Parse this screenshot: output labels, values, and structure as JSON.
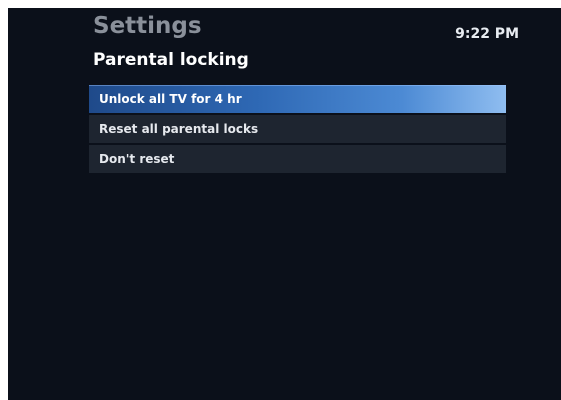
{
  "header": {
    "app_title": "Settings",
    "page_title": "Parental locking",
    "clock": "9:22 PM"
  },
  "menu": {
    "items": [
      {
        "label": "Unlock all TV for 4 hr",
        "selected": true
      },
      {
        "label": "Reset all parental locks",
        "selected": false
      },
      {
        "label": "Don't reset",
        "selected": false
      }
    ]
  },
  "colors": {
    "background": "#0b101a",
    "menu_item": "#1e2530",
    "selected_accent": "#2e68b4"
  }
}
